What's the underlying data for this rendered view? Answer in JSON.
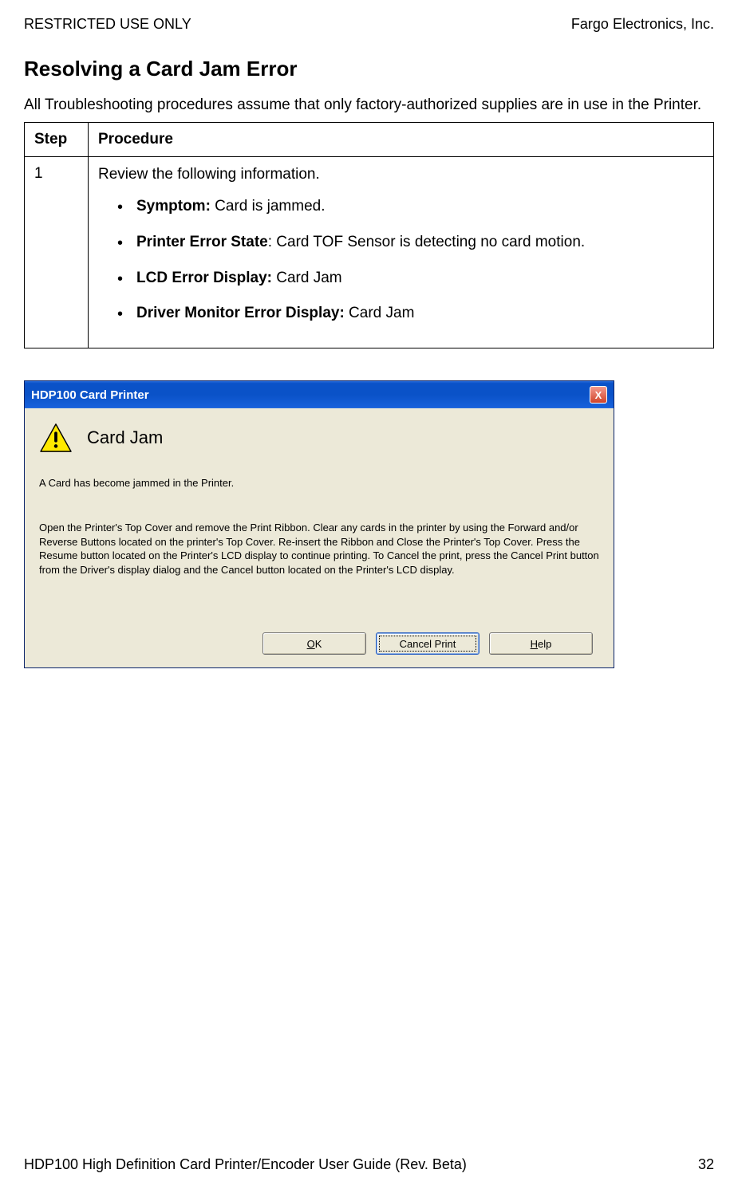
{
  "header": {
    "left": "RESTRICTED USE ONLY",
    "right": "Fargo Electronics, Inc."
  },
  "title": "Resolving a Card Jam Error",
  "intro": "All Troubleshooting procedures assume that only factory-authorized supplies are in use in the Printer.",
  "table": {
    "head_step": "Step",
    "head_proc": "Procedure",
    "row1": {
      "num": "1",
      "lead": "Review the following information.",
      "symptom_label": "Symptom:",
      "symptom_text": "  Card is jammed.",
      "pes_label": "Printer Error State",
      "pes_text": ":  Card TOF Sensor is detecting no card motion.",
      "lcd_label": "LCD Error Display:",
      "lcd_text": "  Card Jam",
      "drv_label": "Driver Monitor Error Display:",
      "drv_text": "  Card Jam"
    }
  },
  "dialog": {
    "title": "HDP100 Card Printer",
    "close": "X",
    "error_title": "Card Jam",
    "short": "A Card has become jammed in the Printer.",
    "long": "Open the Printer's Top Cover and remove the Print Ribbon. Clear any cards in the printer by using the Forward and/or Reverse Buttons located on the printer's Top Cover. Re-insert the Ribbon and Close the Printer's Top Cover. Press the Resume button located on the Printer's LCD display to continue printing. To Cancel the print, press the Cancel Print button from the Driver's display dialog and the Cancel button located on the Printer's LCD display.",
    "buttons": {
      "ok_pre": "O",
      "ok_rest": "K",
      "cancel": "Cancel Print",
      "help_pre": "H",
      "help_rest": "elp"
    }
  },
  "footer": {
    "left": "HDP100 High Definition Card Printer/Encoder User Guide (Rev. Beta)",
    "page": "32"
  }
}
